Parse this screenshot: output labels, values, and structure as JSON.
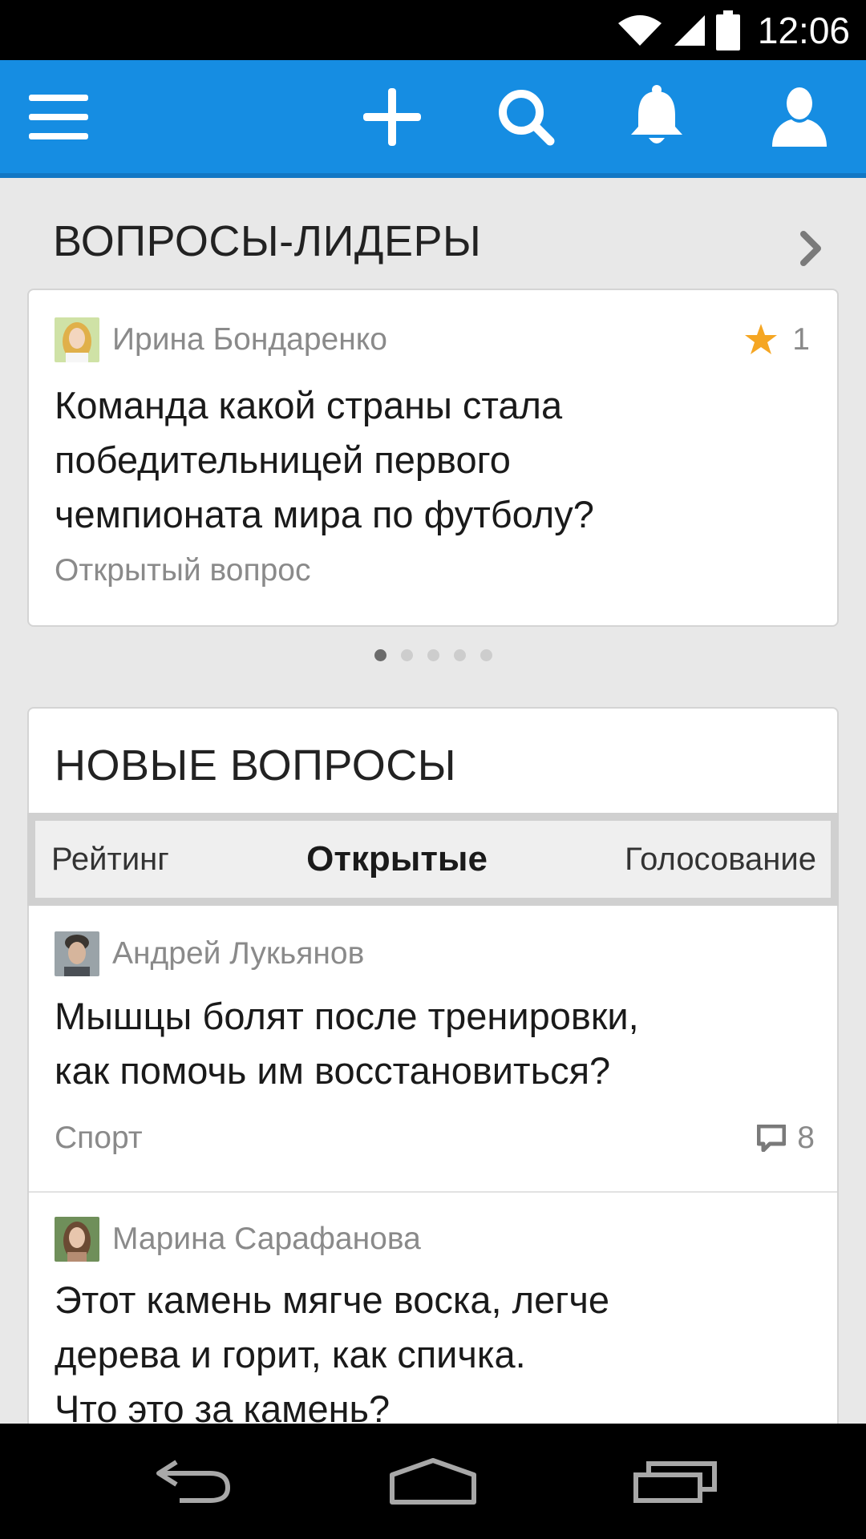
{
  "status_bar": {
    "time": "12:06",
    "icons": [
      "wifi-icon",
      "signal-icon",
      "battery-icon"
    ]
  },
  "app_bar": {
    "icons": [
      "menu-icon",
      "plus-icon",
      "search-icon",
      "bell-icon",
      "profile-icon"
    ],
    "color": "#168de2"
  },
  "leaders": {
    "title": "ВОПРОСЫ-ЛИДЕРЫ",
    "card": {
      "author": "Ирина Бондаренко",
      "rating": "1",
      "question_lines": [
        "Команда какой страны стала",
        "победительницей первого",
        "чемпионата мира по футболу?"
      ],
      "status": "Открытый вопрос"
    },
    "pager": {
      "count": 5,
      "active": 0
    }
  },
  "new_questions": {
    "title": "НОВЫЕ ВОПРОСЫ",
    "tabs": [
      {
        "label": "Рейтинг",
        "active": false
      },
      {
        "label": "Открытые",
        "active": true
      },
      {
        "label": "Голосование",
        "active": false
      }
    ],
    "items": [
      {
        "author": "Андрей Лукьянов",
        "question_lines": [
          "Мышцы болят после тренировки,",
          "как помочь им восстановиться?"
        ],
        "category": "Спорт",
        "comments": "8"
      },
      {
        "author": "Марина Сарафанова",
        "question_lines": [
          "Этот камень мягче воска, легче",
          "дерева и горит, как спичка.",
          "Что это за камень?"
        ]
      }
    ]
  },
  "nav_bar": {
    "icons": [
      "back-icon",
      "home-icon",
      "recents-icon"
    ]
  }
}
